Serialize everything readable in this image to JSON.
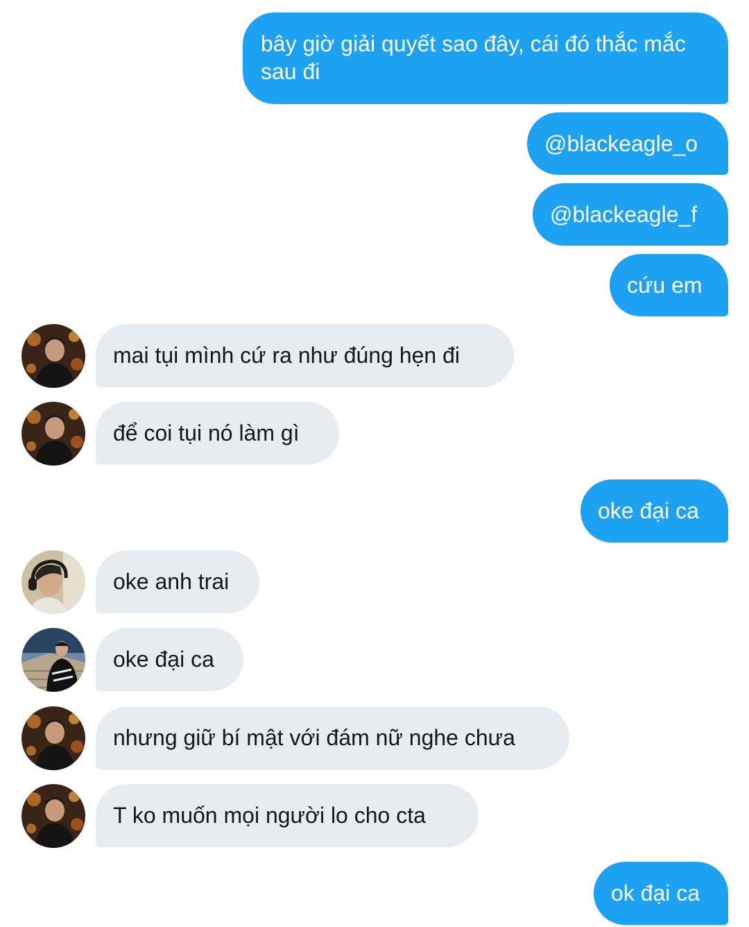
{
  "messages": [
    {
      "direction": "sent",
      "text": "bây giờ giải quyết sao đây, cái đó thắc mắc sau đi"
    },
    {
      "direction": "sent",
      "text": "@blackeagle_o"
    },
    {
      "direction": "sent",
      "text": "@blackeagle_f"
    },
    {
      "direction": "sent",
      "text": "cứu em"
    },
    {
      "direction": "received",
      "avatar": "user-avatar-1",
      "text": "mai tụi mình cứ ra như đúng hẹn đi"
    },
    {
      "direction": "received",
      "avatar": "user-avatar-1",
      "text": "để coi tụi nó làm gì"
    },
    {
      "direction": "sent",
      "text": "oke đại ca"
    },
    {
      "direction": "received",
      "avatar": "user-avatar-2",
      "text": "oke anh trai"
    },
    {
      "direction": "received",
      "avatar": "user-avatar-3",
      "text": "oke đại ca"
    },
    {
      "direction": "received",
      "avatar": "user-avatar-1",
      "text": "nhưng giữ bí mật với đám nữ nghe chưa"
    },
    {
      "direction": "received",
      "avatar": "user-avatar-1",
      "text": "T ko muốn mọi người lo cho cta"
    },
    {
      "direction": "sent",
      "text": "ok đại ca"
    }
  ],
  "colors": {
    "sent_bubble": "#1da1f2",
    "received_bubble": "#e6ecf0",
    "sent_text": "#ffffff",
    "received_text": "#14171a"
  }
}
